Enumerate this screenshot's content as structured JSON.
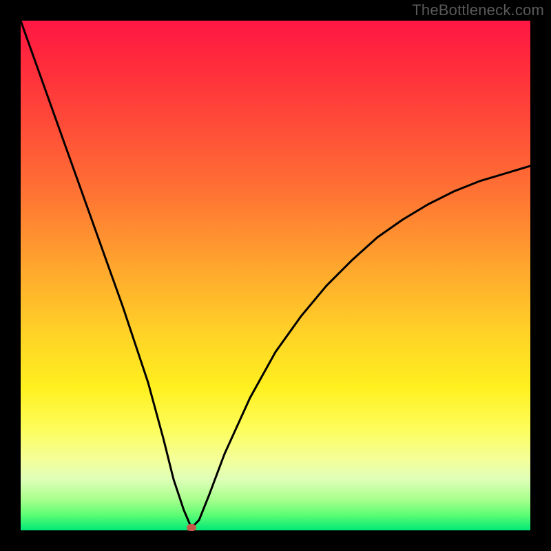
{
  "watermark": "TheBottleneck.com",
  "chart_data": {
    "type": "line",
    "title": "",
    "xlabel": "",
    "ylabel": "",
    "xlim": [
      0,
      100
    ],
    "ylim": [
      0,
      100
    ],
    "series": [
      {
        "name": "curve",
        "x": [
          0,
          5,
          10,
          15,
          20,
          25,
          28,
          30,
          32,
          33.5,
          35,
          37,
          40,
          45,
          50,
          55,
          60,
          65,
          70,
          75,
          80,
          85,
          90,
          95,
          100
        ],
        "values": [
          100,
          86,
          72,
          58,
          44,
          29,
          18,
          10,
          4,
          0.5,
          2,
          7,
          15,
          26,
          35,
          42,
          48,
          53,
          57.5,
          61,
          64,
          66.5,
          68.5,
          70,
          71.5
        ]
      }
    ],
    "marker": {
      "x": 33.5,
      "y": 0.5,
      "color": "#c55a4a"
    },
    "gradient_stops": [
      {
        "pos": 0,
        "color": "#ff1744"
      },
      {
        "pos": 18,
        "color": "#ff4539"
      },
      {
        "pos": 48,
        "color": "#ffa52e"
      },
      {
        "pos": 72,
        "color": "#fff01f"
      },
      {
        "pos": 90,
        "color": "#dfffb8"
      },
      {
        "pos": 100,
        "color": "#00e876"
      }
    ]
  }
}
